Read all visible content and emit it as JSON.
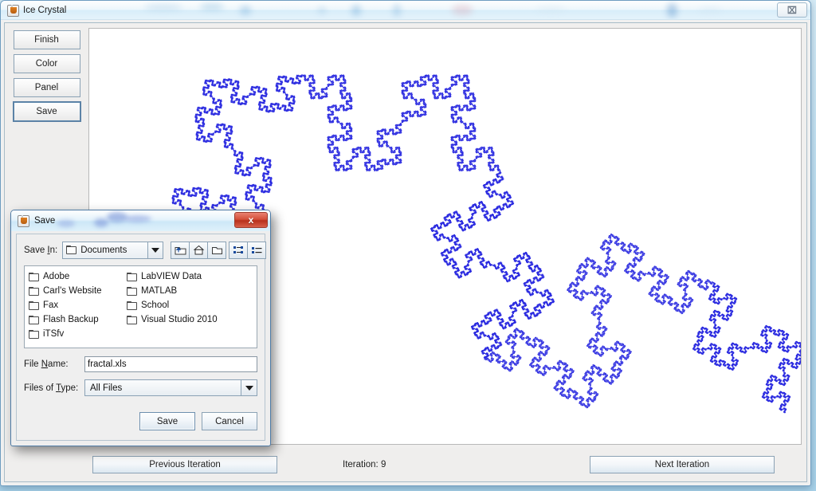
{
  "window": {
    "title": "Ice Crystal",
    "app_icon": "java-coffee-cup-icon",
    "close_label": "⌧"
  },
  "sidebar": {
    "buttons": [
      {
        "label": "Finish",
        "name": "finish-button"
      },
      {
        "label": "Color",
        "name": "color-button"
      },
      {
        "label": "Panel",
        "name": "panel-button"
      },
      {
        "label": "Save",
        "name": "save-button",
        "focused": true
      }
    ]
  },
  "bottom_bar": {
    "previous_label": "Previous Iteration",
    "next_label": "Next Iteration",
    "iteration_text": "Iteration: 9",
    "iteration_value": 9
  },
  "canvas": {
    "name": "fractal-canvas",
    "fractal_type": "quadratic-koch-curve",
    "stroke_color": "#2b2be0",
    "background": "#ffffff"
  },
  "save_dialog": {
    "title": "Save",
    "icon": "java-coffee-cup-icon",
    "close_label": "x",
    "save_in_label": "Save In:",
    "save_in_value": "Documents",
    "toolbar_icons": [
      "folder-up-icon",
      "home-icon",
      "new-folder-icon",
      "tile-view-icon",
      "details-view-icon"
    ],
    "files": [
      "Adobe",
      "Carl's Website",
      "Fax",
      "Flash Backup",
      "iTSfv",
      "LabVIEW Data",
      "MATLAB",
      "School",
      "Visual Studio 2010"
    ],
    "file_name_label": "File Name:",
    "file_name_value": "fractal.xls",
    "files_of_type_label": "Files of Type:",
    "files_of_type_value": "All Files",
    "save_button": "Save",
    "cancel_button": "Cancel"
  },
  "colors": {
    "accent": "#2b2be0",
    "titlebar": "#dceefa",
    "close_red": "#d4503a",
    "panel_bg": "#efeeed"
  }
}
